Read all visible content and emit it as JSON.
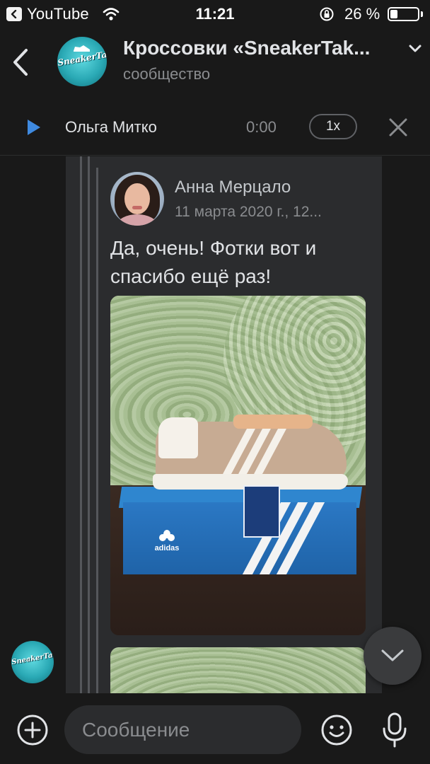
{
  "status_bar": {
    "back_app": "YouTube",
    "time": "11:21",
    "battery_text": "26 %",
    "battery_level": 0.26
  },
  "header": {
    "title": "Кроссовки «SneakerTak...",
    "subtitle": "сообщество",
    "avatar_logo_text": "SneakerTakes"
  },
  "player": {
    "author": "Ольга Митко",
    "time": "0:00",
    "speed": "1x"
  },
  "quoted_post": {
    "author": "Анна Мерцало",
    "date": "11 марта 2020 г., 12...",
    "text": "Да, очень! Фотки вот и спасибо ещё раз!",
    "photo_box_logo": "adidas"
  },
  "composer": {
    "placeholder": "Сообщение"
  },
  "colors": {
    "background": "#191919",
    "bubble": "#2b2c2e",
    "accent": "#3f8ae0",
    "text_primary": "#e1e3e6",
    "text_secondary": "#8a8c8f"
  },
  "icons": {
    "back": "chevron-left-icon",
    "expand": "chevron-down-icon",
    "play": "play-icon",
    "close": "close-icon",
    "scroll_down": "chevron-down-icon",
    "add": "plus-circle-icon",
    "emoji": "smile-icon",
    "mic": "microphone-icon"
  }
}
